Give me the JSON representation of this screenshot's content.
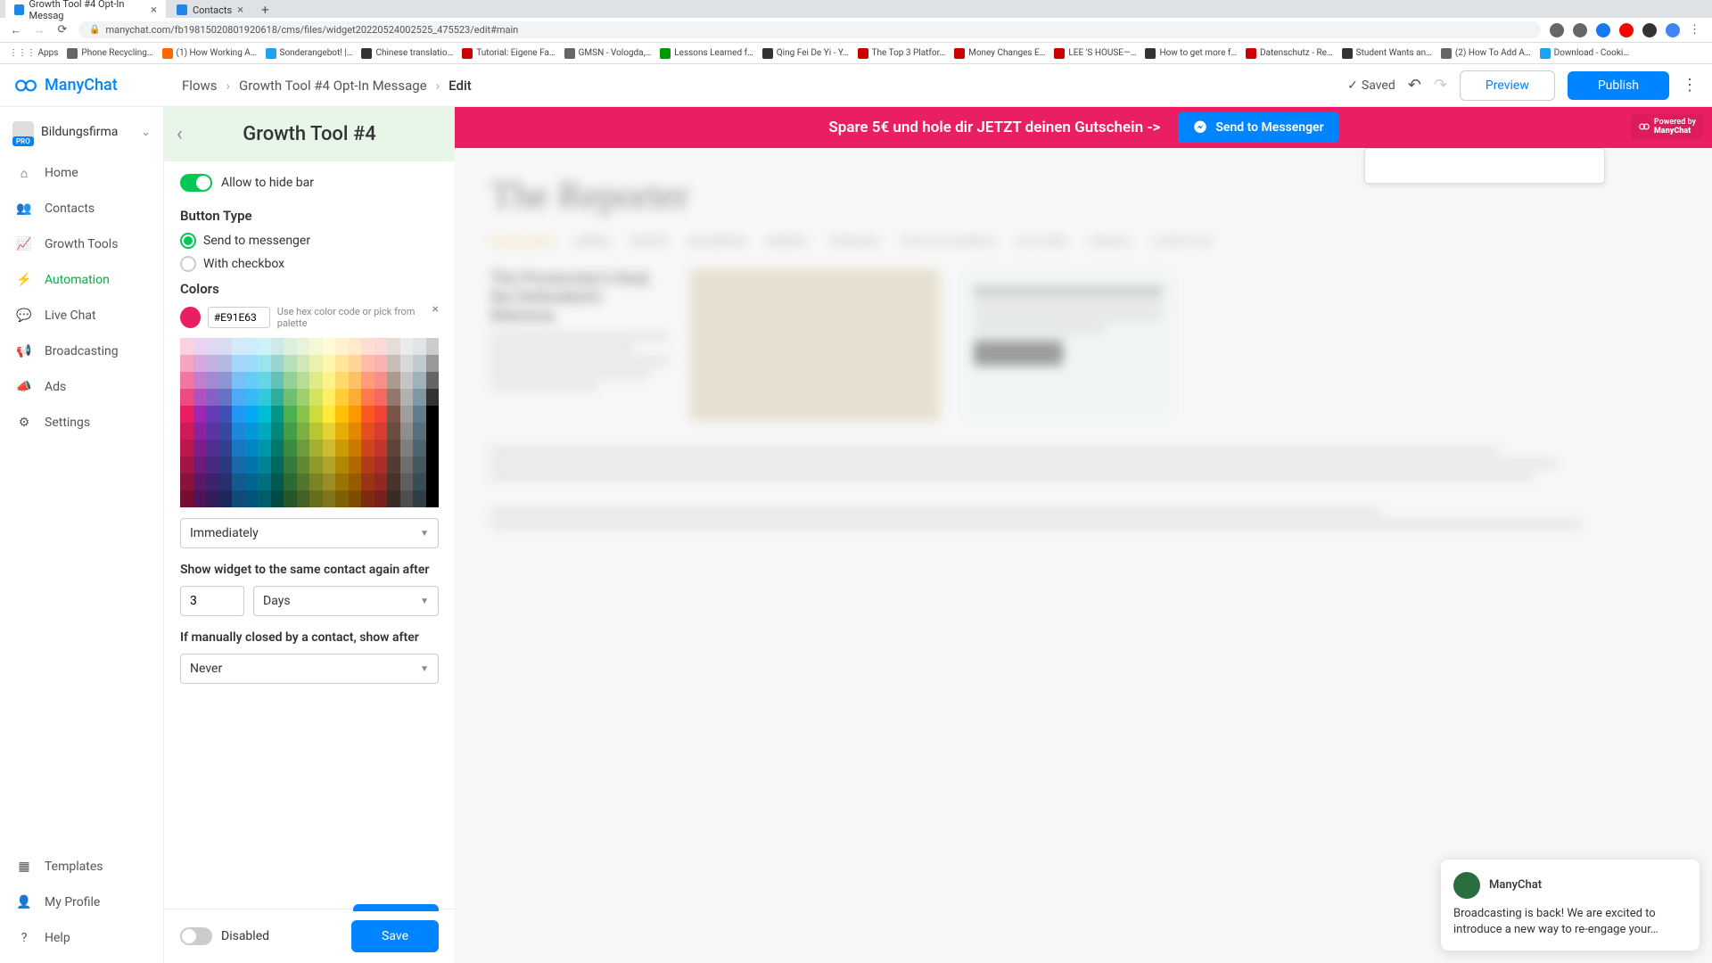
{
  "browser": {
    "tabs": [
      {
        "title": "Growth Tool #4 Opt-In Messag"
      },
      {
        "title": "Contacts"
      }
    ],
    "url": "manychat.com/fb198150208019206​18/cms/files/widget20220524002525_475523/edit#main",
    "bookmarks": [
      "Apps",
      "Phone Recycling…",
      "(1) How Working A…",
      "Sonderangebot! |…",
      "Chinese translatio…",
      "Tutorial: Eigene Fa…",
      "GMSN - Vologda,…",
      "Lessons Learned f…",
      "Qing Fei De Yi - Y…",
      "The Top 3 Platfor…",
      "Money Changes E…",
      "LEE 'S HOUSE—…",
      "How to get more f…",
      "Datenschutz - Re…",
      "Student Wants an…",
      "(2) How To Add A…",
      "Download - Cooki…"
    ]
  },
  "topbar": {
    "logo": "ManyChat",
    "crumbs": [
      "Flows",
      "Growth Tool #4 Opt-In Message",
      "Edit"
    ],
    "saved": "Saved",
    "preview": "Preview",
    "publish": "Publish"
  },
  "sidebar": {
    "org_name": "Bildungsfirma",
    "pro": "PRO",
    "items": [
      "Home",
      "Contacts",
      "Growth Tools",
      "Automation",
      "Live Chat",
      "Broadcasting",
      "Ads",
      "Settings"
    ],
    "active_index": 3,
    "bottom": [
      "Templates",
      "My Profile",
      "Help"
    ]
  },
  "config": {
    "title": "Growth Tool #4",
    "allow_hide": "Allow to hide bar",
    "button_type_title": "Button Type",
    "radio_send": "Send to messenger",
    "radio_checkbox": "With checkbox",
    "colors_title": "Colors",
    "hex": "#E91E63",
    "hex_hint": "Use hex color code or pick from palette",
    "show_when_label": "Show widget to the same contact again after",
    "immediately": "Immediately",
    "again_value": "3",
    "again_unit": "Days",
    "closed_label": "If manually closed by a contact, show after",
    "never": "Never",
    "disabled": "Disabled",
    "save": "Save"
  },
  "widget": {
    "headline": "Spare 5€ und hole dir JETZT deinen Gutschein ->",
    "button": "Send to Messenger",
    "powered": "Powered by",
    "powered_brand": "ManyChat"
  },
  "notification": {
    "title": "ManyChat",
    "body": "Broadcasting is back! We are excited to introduce a new way to re-engage your…"
  },
  "chart_data": null,
  "palette_hues": [
    "#e91e63",
    "#9c27b0",
    "#673ab7",
    "#3f51b5",
    "#2196f3",
    "#03a9f4",
    "#00bcd4",
    "#009688",
    "#4caf50",
    "#8bc34a",
    "#cddc39",
    "#ffeb3b",
    "#ffc107",
    "#ff9800",
    "#ff5722",
    "#f44336",
    "#795548",
    "#9e9e9e",
    "#607d8b",
    "#000000"
  ],
  "palette_lightness": [
    0.9,
    0.8,
    0.7,
    0.6,
    0.5,
    0.45,
    0.4,
    0.35,
    0.3,
    0.25
  ]
}
